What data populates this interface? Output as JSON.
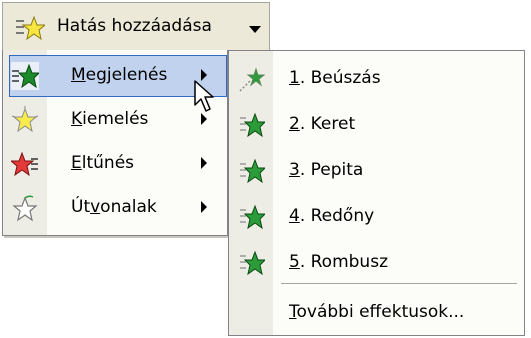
{
  "button": {
    "label": "Hatás hozzáadása",
    "icon": "add-effect-star-icon"
  },
  "menu": {
    "items": [
      {
        "mnemonic": "M",
        "rest": "egjelenés",
        "icon": "entrance-star-icon",
        "selected": true,
        "has_submenu": true
      },
      {
        "mnemonic": "K",
        "rest": "iemelés",
        "icon": "emphasis-star-icon",
        "selected": false,
        "has_submenu": true
      },
      {
        "mnemonic": "E",
        "rest": "ltűnés",
        "icon": "exit-star-icon",
        "selected": false,
        "has_submenu": true
      },
      {
        "pre": "Út",
        "mnemonic": "v",
        "rest": "onalak",
        "icon": "motion-path-star-icon",
        "selected": false,
        "has_submenu": true
      }
    ]
  },
  "submenu": {
    "items": [
      {
        "mnemonic": "1",
        "rest": ". Beúszás",
        "icon": "fly-in-effect-icon"
      },
      {
        "mnemonic": "2",
        "rest": ". Keret",
        "icon": "box-effect-icon"
      },
      {
        "mnemonic": "3",
        "rest": ". Pepita",
        "icon": "checkerboard-effect-icon"
      },
      {
        "mnemonic": "4",
        "rest": ". Redőny",
        "icon": "blinds-effect-icon"
      },
      {
        "mnemonic": "5",
        "rest": ". Rombusz",
        "icon": "diamond-effect-icon"
      }
    ],
    "more": {
      "mnemonic": "T",
      "rest": "ovábbi effektusok..."
    }
  },
  "colors": {
    "menu_bg": "#fcfcf9",
    "icon_strip": "#eeede5",
    "highlight_bg": "#c1d2ee",
    "highlight_border": "#316ac5"
  }
}
